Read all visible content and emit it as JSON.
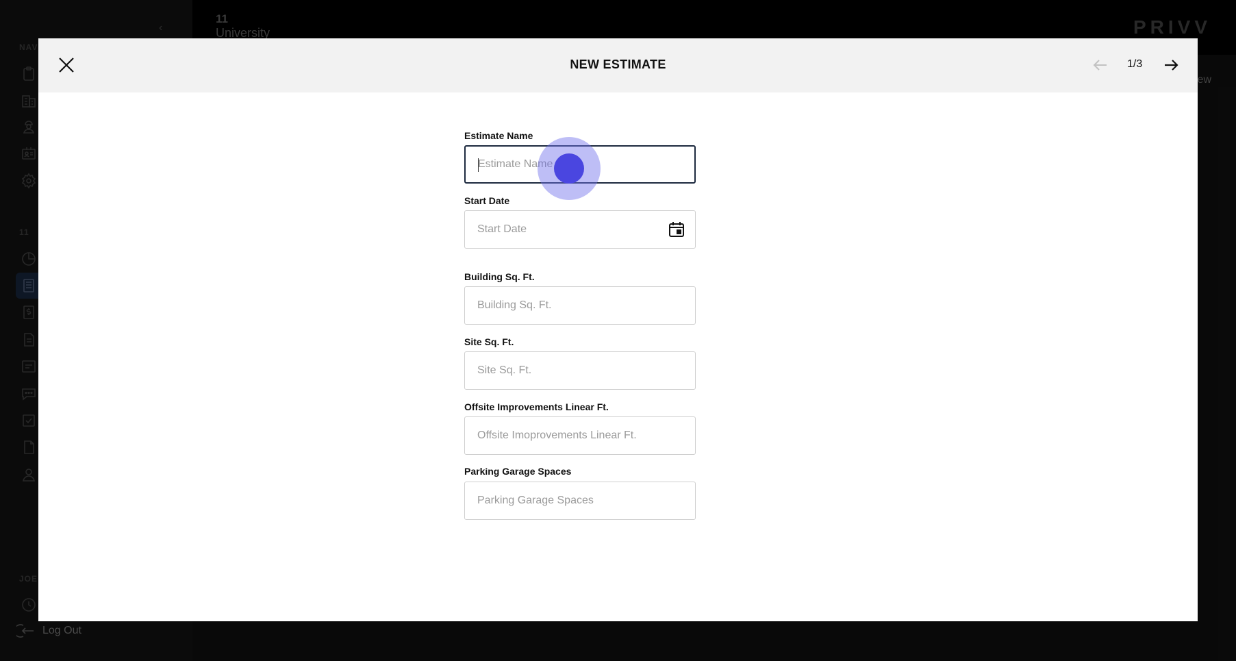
{
  "app": {
    "project_number": "11",
    "project_name": "University",
    "brand": "PRIVV",
    "bg_view_label": "iew",
    "sidebar": {
      "section_nav": "NAV",
      "section_project": "11",
      "section_user": "JOE",
      "logout_label": "Log Out",
      "nav_icons": [
        "clipboard-icon",
        "buildings-icon",
        "worker-icon",
        "contact-card-icon",
        "settings-icon"
      ],
      "project_icons": [
        "pie-chart-icon",
        "estimate-icon",
        "dollar-icon",
        "document-icon",
        "list-icon",
        "chat-icon",
        "checkbox-icon",
        "file-icon",
        "user-icon"
      ],
      "active_item": "estimate-icon"
    }
  },
  "modal": {
    "title": "NEW ESTIMATE",
    "page_indicator": "1/3",
    "fields": {
      "estimate_name": {
        "label": "Estimate Name",
        "placeholder": "Estimate Name",
        "value": ""
      },
      "start_date": {
        "label": "Start Date",
        "placeholder": "Start Date",
        "value": ""
      },
      "building_sqft": {
        "label": "Building Sq. Ft.",
        "placeholder": "Building Sq. Ft.",
        "value": ""
      },
      "site_sqft": {
        "label": "Site Sq. Ft.",
        "placeholder": "Site Sq. Ft.",
        "value": ""
      },
      "offsite_linear_ft": {
        "label": "Offsite Improvements Linear Ft.",
        "placeholder": "Offsite Imoprovements Linear Ft.",
        "value": ""
      },
      "parking_spaces": {
        "label": "Parking Garage Spaces",
        "placeholder": "Parking Garage Spaces",
        "value": ""
      }
    }
  },
  "colors": {
    "focus_border": "#1d2a3f",
    "click_indicator": "#4a46e0",
    "header_bg": "#f2f2f2"
  }
}
